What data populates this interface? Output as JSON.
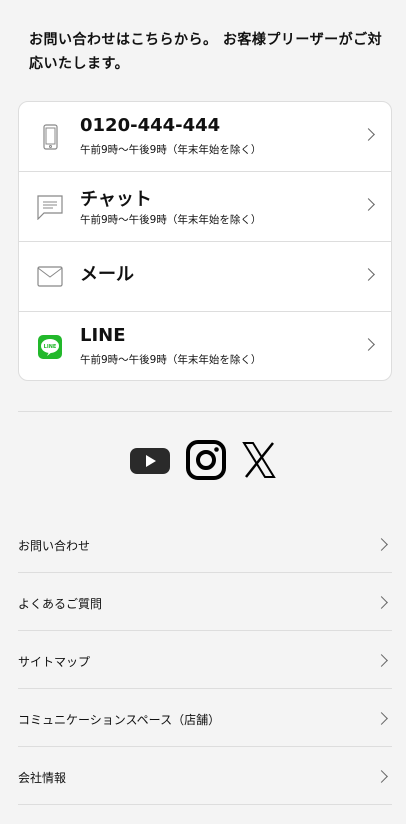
{
  "intro": "お問い合わせはこちらから。 お客様プリーザーがご対応いたします。",
  "contacts": [
    {
      "title": "0120-444-444",
      "sub": "午前9時〜午後9時（年末年始を除く）",
      "icon": "phone-icon"
    },
    {
      "title": "チャット",
      "sub": "午前9時〜午後9時（年末年始を除く）",
      "icon": "chat-icon"
    },
    {
      "title": "メール",
      "icon": "mail-icon"
    },
    {
      "title": "LINE",
      "sub": "午前9時〜午後9時（年末年始を除く）",
      "icon": "line-icon"
    }
  ],
  "social": [
    "youtube-icon",
    "instagram-icon",
    "x-icon"
  ],
  "line_color": "#22b82b",
  "links": [
    "お問い合わせ",
    "よくあるご質問",
    "サイトマップ",
    "コミュニケーションスペース（店舗）",
    "会社情報"
  ]
}
